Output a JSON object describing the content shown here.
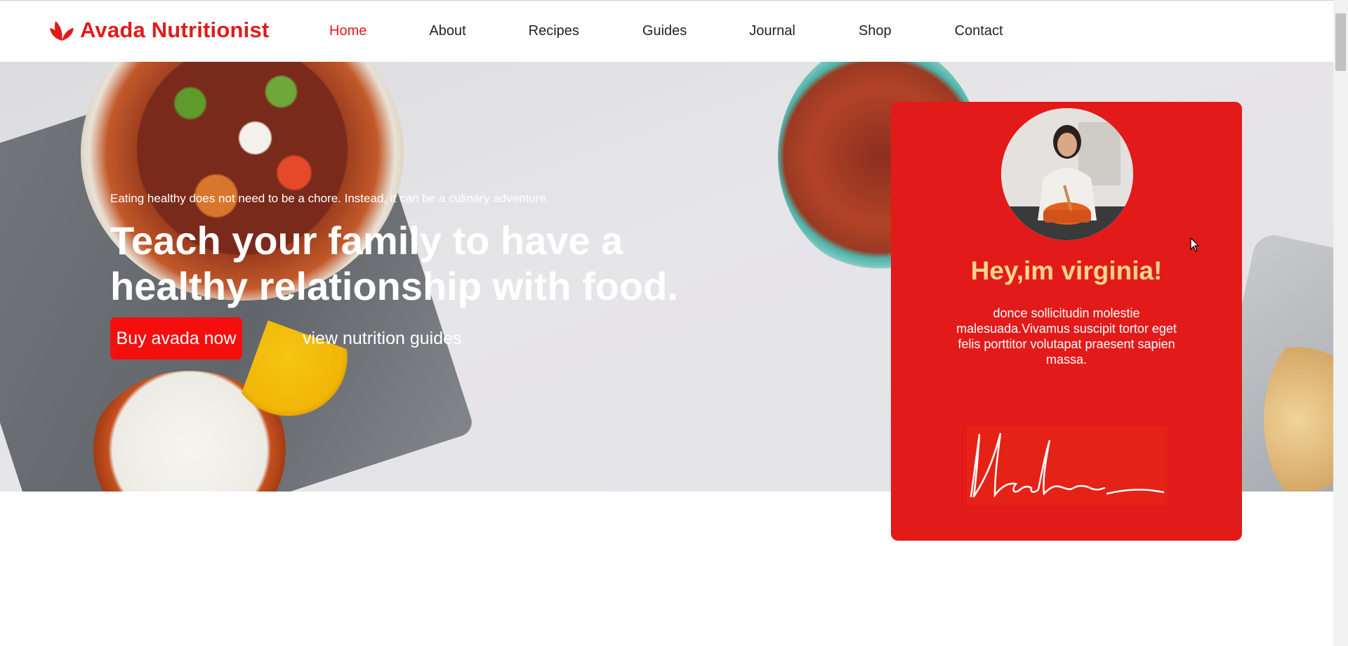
{
  "brand": {
    "name": "Avada Nutritionist",
    "icon": "leaf-logo-icon",
    "color": "#e21b1b"
  },
  "nav": {
    "items": [
      {
        "label": "Home",
        "active": true
      },
      {
        "label": "About",
        "active": false
      },
      {
        "label": "Recipes",
        "active": false
      },
      {
        "label": "Guides",
        "active": false
      },
      {
        "label": "Journal",
        "active": false
      },
      {
        "label": "Shop",
        "active": false
      },
      {
        "label": "Contact",
        "active": false
      }
    ]
  },
  "hero": {
    "kicker": "Eating healthy does not need to be a chore. Instead, it can be a culinary adventure.",
    "title": "Teach your family to have a healthy relationship with food.",
    "primary_button": "Buy avada now",
    "secondary_link": "view nutrition guides",
    "button_color": "#f50e0e"
  },
  "profile": {
    "title": "Hey,im virginia!",
    "text": "donce sollicitudin molestie malesuada.Vivamus suscipit tortor eget felis porttitor volutapat praesent sapien massa.",
    "card_color": "#e31a1a",
    "title_color": "#f7d58c",
    "avatar_icon": "woman-cooking-photo",
    "signature_icon": "handwritten-signature"
  }
}
